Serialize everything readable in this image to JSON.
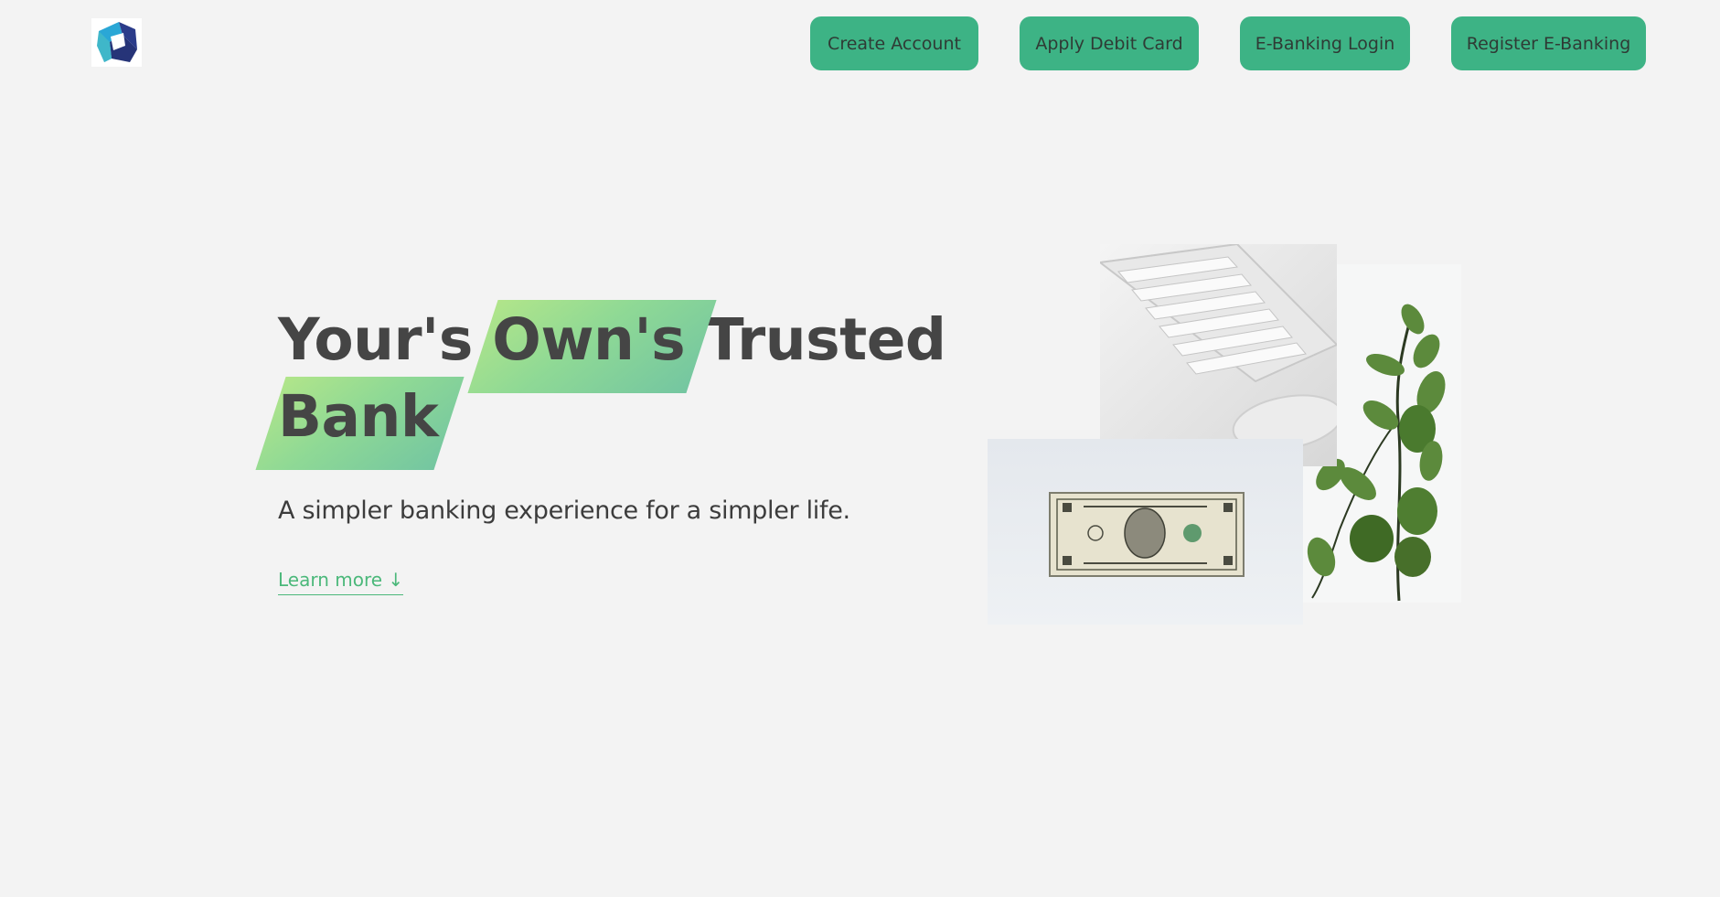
{
  "header": {
    "logo_icon": "bank-logo-icon",
    "nav": [
      {
        "label": "Create Account"
      },
      {
        "label": "Apply Debit Card"
      },
      {
        "label": "E-Banking Login"
      },
      {
        "label": "Register E-Banking"
      }
    ]
  },
  "hero": {
    "headline": {
      "word1": "Your's",
      "word2": "Own's",
      "word3": "Trusted",
      "word4": "Bank"
    },
    "tagline": "A simpler banking experience for a simpler life.",
    "learn_more": "Learn more ↓"
  },
  "collage": {
    "images": [
      {
        "icon": "keyboard-mouse-photo"
      },
      {
        "icon": "plant-photo"
      },
      {
        "icon": "dollar-bill-photo"
      }
    ]
  },
  "colors": {
    "accent_green": "#3db385",
    "link_green": "#4bb87a",
    "background": "#f3f3f3",
    "text_dark": "#454545"
  }
}
